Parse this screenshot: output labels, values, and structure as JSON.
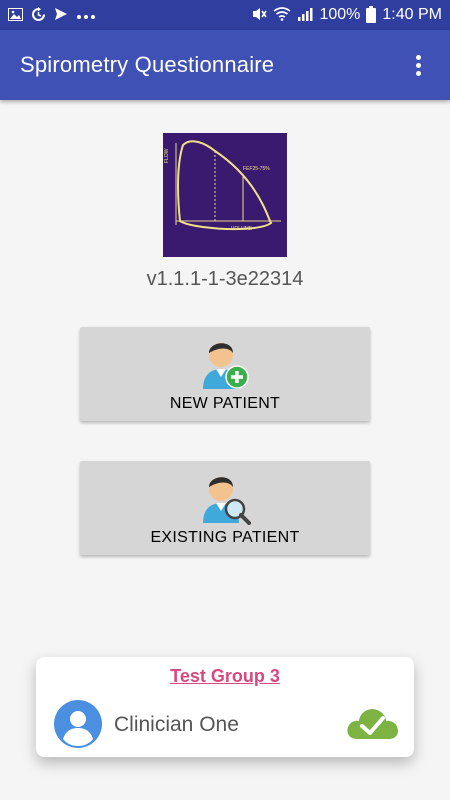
{
  "status_bar": {
    "battery": "100%",
    "time": "1:40 PM",
    "left_icons": [
      "image-icon",
      "sync-icon",
      "send-icon",
      "more-dots-icon"
    ],
    "right_icons": [
      "mute-icon",
      "wifi-icon",
      "signal-icon",
      "battery-icon"
    ]
  },
  "app_bar": {
    "title": "Spirometry Questionnaire"
  },
  "logo": {
    "flow_label": "FLOW",
    "volume_label": "VOLUME",
    "fef_label": "FEF25-75%"
  },
  "version": "v1.1.1-1-3e22314",
  "buttons": {
    "new_patient": "NEW PATIENT",
    "existing_patient": "EXISTING PATIENT"
  },
  "footer_card": {
    "group": "Test Group 3",
    "clinician": "Clinician One"
  },
  "colors": {
    "status_bar": "#303f9f",
    "app_bar": "#3f51b5",
    "group_link": "#d9487f",
    "avatar": "#4a8fe0",
    "cloud": "#7cb342"
  }
}
